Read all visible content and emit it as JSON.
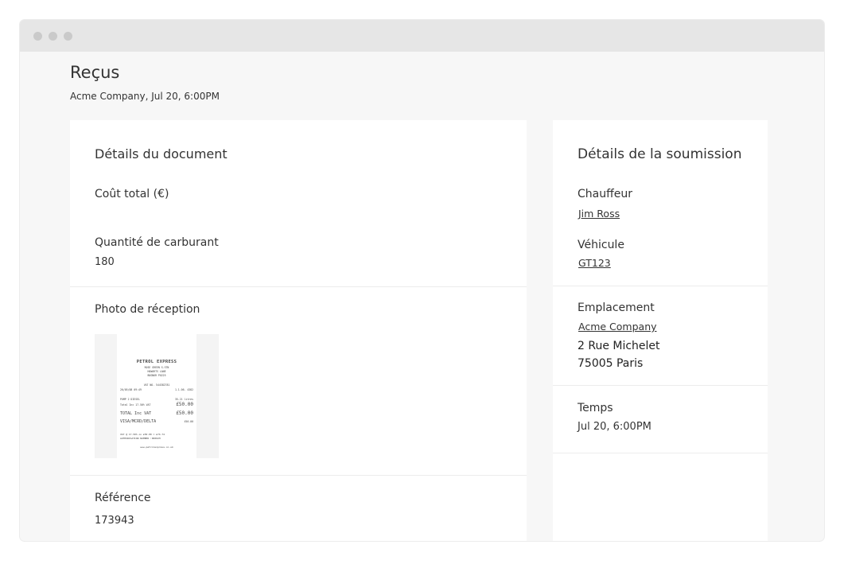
{
  "page": {
    "title": "Reçus",
    "subtitle": "Acme Company, Jul 20, 6:00PM"
  },
  "document": {
    "heading": "Détails du document",
    "total_cost_label": "Coût total (€)",
    "total_cost_value": "",
    "fuel_quantity_label": "Quantité de carburant",
    "fuel_quantity_value": "180",
    "photo_label": "Photo de réception",
    "reference_label": "Référence",
    "reference_value": "173943"
  },
  "receipt": {
    "station": "PETROL EXPRESS",
    "addr1": "ROSE GREEN S-STN",
    "addr2": "HOWARTS LANE",
    "addr3": "BOGNOR PO225",
    "vat_no": "VAT NO. 544382781",
    "date": "20/05/08 09:49",
    "code": "1.1.06.  4382",
    "pump": "PUMP  2 DIESEL",
    "litres": "35.21 litres",
    "total_incl": "Total Inc 17.50% VAT",
    "amount1": "£50.00",
    "total_label": "TOTAL Inc VAT",
    "amount2": "£50.00",
    "card": "VISA/MCRD/DELTA",
    "card_amount": "£50.00",
    "vat_line": "VAT @ 17.50% on  £50.00 = £74.74",
    "auth": "AUTHORISATION NUMBER :00002H",
    "web": "www.petrolexpress.co.uk"
  },
  "submission": {
    "heading": "Détails de la soumission",
    "driver_label": "Chauffeur",
    "driver_name": "Jim Ross",
    "vehicle_label": "Véhicule",
    "vehicle_id": "GT123",
    "location_label": "Emplacement",
    "location_name": "Acme Company",
    "address_line1": "2 Rue Michelet",
    "address_line2": "75005 Paris",
    "time_label": "Temps",
    "time_value": "Jul 20, 6:00PM"
  },
  "window": {
    "controls": [
      "close",
      "minimize",
      "maximize"
    ]
  }
}
